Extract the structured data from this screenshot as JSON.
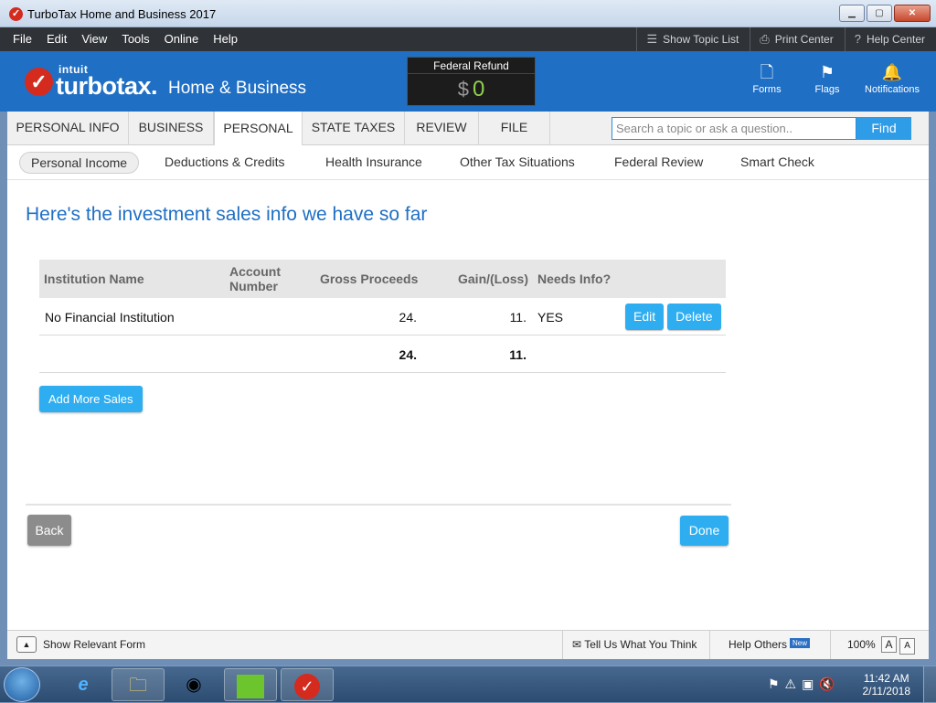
{
  "window": {
    "title": "TurboTax Home and Business 2017"
  },
  "menubar": {
    "menus": [
      "File",
      "Edit",
      "View",
      "Tools",
      "Online",
      "Help"
    ],
    "show_topic_list": "Show Topic List",
    "print_center": "Print Center",
    "help_center": "Help Center"
  },
  "brand": {
    "intuit": "intuit",
    "name": "turbotax.",
    "edition": "Home & Business",
    "refund_label": "Federal Refund",
    "refund_currency": "$",
    "refund_amount": "0",
    "actions": [
      "Forms",
      "Flags",
      "Notifications"
    ]
  },
  "tabs": [
    "PERSONAL INFO",
    "BUSINESS",
    "PERSONAL",
    "STATE TAXES",
    "REVIEW",
    "FILE"
  ],
  "active_tab": "PERSONAL",
  "search": {
    "placeholder": "Search a topic or ask a question..",
    "button": "Find"
  },
  "subnav": [
    "Personal Income",
    "Deductions & Credits",
    "Health Insurance",
    "Other Tax Situations",
    "Federal Review",
    "Smart Check"
  ],
  "active_subnav": "Personal Income",
  "main": {
    "heading": "Here's the investment sales info we have so far",
    "columns": {
      "institution": "Institution Name",
      "account": "Account Number",
      "gross": "Gross Proceeds",
      "gain": "Gain/(Loss)",
      "needs": "Needs Info?"
    },
    "rows": [
      {
        "institution": "No Financial Institution",
        "account": "",
        "gross": "24.",
        "gain": "11.",
        "needs": "YES"
      }
    ],
    "row_buttons": {
      "edit": "Edit",
      "delete": "Delete"
    },
    "totals": {
      "gross": "24.",
      "gain": "11."
    },
    "add_more": "Add More Sales",
    "back": "Back",
    "done": "Done"
  },
  "statusbar": {
    "show_form": "Show Relevant Form",
    "tell_us": "Tell Us What You Think",
    "help_others": "Help Others",
    "new_badge": "New",
    "zoom": "100%",
    "zoom_a1": "A",
    "zoom_a2": "A"
  },
  "taskbar": {
    "time": "11:42 AM",
    "date": "2/11/2018"
  },
  "colors": {
    "brand_blue": "#1f6fc5",
    "button_blue": "#2eaef0",
    "menubar": "#2f3237",
    "refund_green": "#8fd14f"
  }
}
